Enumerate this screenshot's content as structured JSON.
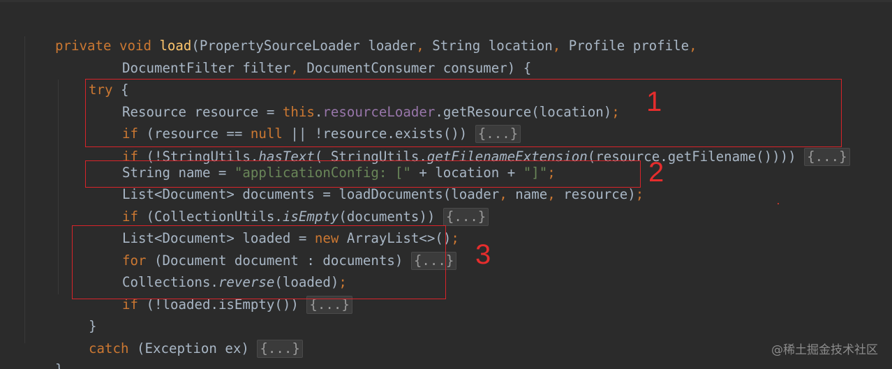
{
  "code": {
    "line1": {
      "t1": "private",
      "t2": " ",
      "t3": "void",
      "t4": " ",
      "t5": "load",
      "t6": "(PropertySourceLoader loader",
      "t7": ",",
      "t8": " String location",
      "t9": ",",
      "t10": " Profile profile",
      "t11": ","
    },
    "line2": {
      "t1": "DocumentFilter filter",
      "t2": ",",
      "t3": " DocumentConsumer consumer) {"
    },
    "line3": {
      "t1": "try",
      "t2": " {"
    },
    "line4": {
      "t1": "Resource resource = ",
      "t2": "this",
      "t3": ".",
      "t4": "resourceLoader",
      "t5": ".getResource(location)",
      "t6": ";"
    },
    "line5": {
      "t1": "if",
      "t2": " (resource == ",
      "t3": "null",
      "t4": " || !resource.exists()) ",
      "fold": "{...}"
    },
    "line6": {
      "t1": "if",
      "t2": " (!StringUtils.",
      "t3": "hasText",
      "t4": "( StringUtils.",
      "t5": "getFilenameExtension",
      "t6": "(resource.getFilename()))) ",
      "fold": "{...}"
    },
    "line7": {
      "t1": "String name = ",
      "t2": "\"applicationConfig: [\"",
      "t3": " + location + ",
      "t4": "\"]\"",
      "t5": ";"
    },
    "line8": {
      "t1": "List<Document> documents = loadDocuments(loader",
      "t2": ",",
      "t3": " name",
      "t4": ",",
      "t5": " resource)",
      "t6": ";"
    },
    "line9": {
      "t1": "if",
      "t2": " (CollectionUtils.",
      "t3": "isEmpty",
      "t4": "(documents)) ",
      "fold": "{...}"
    },
    "line10": {
      "t1": "List<Document> loaded = ",
      "t2": "new",
      "t3": " ArrayList<>()",
      "t4": ";"
    },
    "line11": {
      "t1": "for",
      "t2": " (Document document : documents) ",
      "fold": "{...}"
    },
    "line12": {
      "t1": "Collections.",
      "t2": "reverse",
      "t3": "(loaded)",
      "t4": ";"
    },
    "line13": {
      "t1": "if",
      "t2": " (!loaded.isEmpty()) ",
      "fold": "{...}"
    },
    "line14": {
      "t1": "}"
    },
    "line15": {
      "t1": "catch",
      "t2": " (Exception ex) ",
      "fold": "{...}"
    },
    "line16": {
      "t1": "}"
    }
  },
  "annotations": {
    "box1": {
      "number": "1"
    },
    "box2": {
      "number": "2"
    },
    "box3": {
      "number": "3"
    }
  },
  "watermark": "@稀土掘金技术社区",
  "colors": {
    "background": "#2b2b2b",
    "default_text": "#a9b7c6",
    "keyword": "#cc7832",
    "method_declaration": "#ffc66d",
    "field": "#9876aa",
    "string": "#6a8759",
    "annotation_red": "#e52d2d"
  }
}
